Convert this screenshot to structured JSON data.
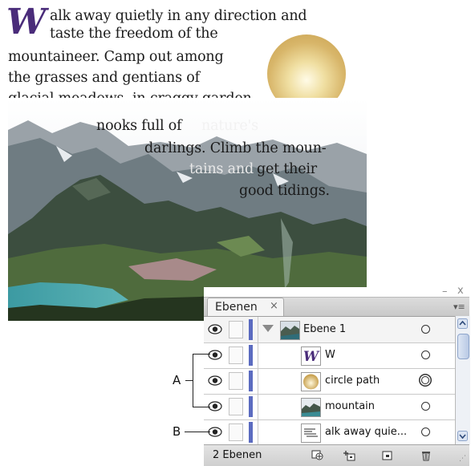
{
  "artwork": {
    "drop_cap": "W",
    "text_lines": [
      "alk away quietly in any direction and",
      "taste the freedom of the",
      "mountaineer. Camp out among",
      "the grasses and gentians of",
      "glacial meadows, in craggy garden",
      "nooks full of",
      "nature's",
      "darlings. Climb the moun-",
      "tains and",
      "get their",
      "good tidings."
    ],
    "circle_color": "#d8b66a"
  },
  "panel": {
    "tab_label": "Ebenen",
    "close_glyph": "×",
    "minimize_glyph": "–",
    "window_close_glyph": "x",
    "menu_glyph": "▾≡",
    "layers": [
      {
        "name": "Ebene 1",
        "icon": "photo-layer-icon",
        "selected": true
      },
      {
        "name": "W",
        "icon": "w-dropcap-thumbnail"
      },
      {
        "name": "circle path",
        "icon": "circle-thumbnail"
      },
      {
        "name": "mountain",
        "icon": "mountain-thumbnail"
      },
      {
        "name": "alk away quie...",
        "icon": "text-path-thumbnail"
      }
    ],
    "layer_count": "2 Ebenen",
    "accent_color": "#5b6bc0"
  },
  "callouts": {
    "a": "A",
    "b": "B"
  }
}
